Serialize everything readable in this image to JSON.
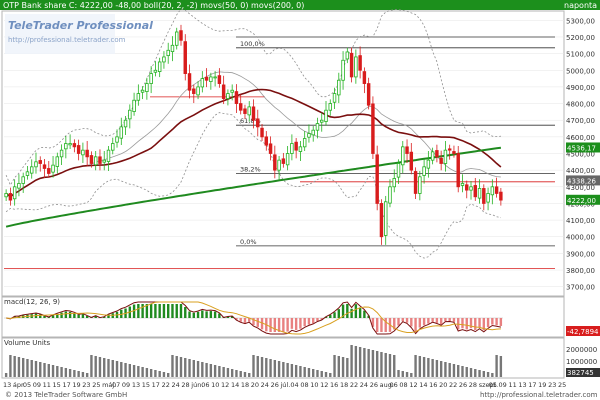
{
  "header": {
    "title": "OTP Bank share  C: 4222,00 -48,00 boll(20, 2, -2) movs(50, 0) movs(200, 0)",
    "right_label": "napontа"
  },
  "watermark": {
    "brand": "TeleTrader Professional",
    "url": "http://professional.teletrader.com"
  },
  "colors": {
    "up": "#22b21f",
    "down": "#d81d1d",
    "ma50": "#7a0f0f",
    "ma200": "#1f8a1f",
    "boll": "#8f8f8f",
    "header_bg": "#1c8f1c",
    "price_tag": "#1c8f1c",
    "sell_tag": "#d81d1d"
  },
  "price_panel": {
    "y_ticks": [
      "5300,00",
      "5200,00",
      "5100,00",
      "5000,00",
      "4900,00",
      "4800,00",
      "4700,00",
      "4600,00",
      "4500,00",
      "4400,00",
      "4300,00",
      "4200,00",
      "4100,00",
      "4000,00",
      "3900,00",
      "3800,00",
      "3700,00"
    ],
    "fib_labels": [
      "100,0%",
      "61,8%",
      "38,2%",
      "0,0%"
    ],
    "fib_levels": [
      5135,
      4670,
      4380,
      3945
    ],
    "price_tags": [
      "4536,17",
      "4222,00",
      "4338,26"
    ],
    "last_price": 4222
  },
  "macd_panel": {
    "title": "macd(12, 26, 9)",
    "value_tag": "-42,7894"
  },
  "volume_panel": {
    "title": "Volume Units",
    "ticks": [
      "2000000",
      "1000000"
    ],
    "value_tag": "382745"
  },
  "x_axis": {
    "labels": [
      "13",
      "ápr.",
      "05",
      "09",
      "11",
      "15",
      "17",
      "19",
      "23",
      "25",
      "máj.",
      "07",
      "09",
      "13",
      "15",
      "17",
      "22",
      "24",
      "28",
      "jún.",
      "06",
      "10",
      "12",
      "14",
      "18",
      "20",
      "24",
      "26",
      "júl.",
      "04",
      "08",
      "10",
      "12",
      "16",
      "18",
      "22",
      "24",
      "26",
      "aug.",
      "06",
      "08",
      "12",
      "14",
      "16",
      "20",
      "22",
      "26",
      "28",
      "szept.",
      "05",
      "09",
      "11",
      "13",
      "17",
      "19",
      "23",
      "25"
    ]
  },
  "footer": {
    "copyright": "© 2013 TeleTrader Software GmbH",
    "url": "http://professional.teletrader.com"
  },
  "chart_data": [
    {
      "type": "candlestick",
      "title": "OTP Bank share",
      "ylim": [
        3650,
        5350
      ],
      "last": 4222,
      "change": -48,
      "closes": [
        4260,
        4220,
        4300,
        4320,
        4360,
        4390,
        4420,
        4450,
        4440,
        4410,
        4380,
        4430,
        4480,
        4520,
        4560,
        4560,
        4540,
        4500,
        4520,
        4480,
        4440,
        4480,
        4440,
        4460,
        4520,
        4560,
        4600,
        4660,
        4700,
        4760,
        4820,
        4860,
        4880,
        4920,
        4980,
        5000,
        5050,
        5080,
        5120,
        5150,
        5230,
        5180,
        4980,
        4880,
        4860,
        4900,
        4950,
        4940,
        4960,
        4960,
        4920,
        4830,
        4860,
        4880,
        4800,
        4760,
        4740,
        4780,
        4700,
        4660,
        4600,
        4550,
        4500,
        4400,
        4460,
        4440,
        4500,
        4560,
        4520,
        4540,
        4590,
        4620,
        4640,
        4680,
        4700,
        4760,
        4800,
        4860,
        4940,
        5060,
        5110,
        4960,
        5080,
        5000,
        4920,
        4790,
        4500,
        4200,
        4000,
        4210,
        4300,
        4350,
        4440,
        4540,
        4500,
        4400,
        4260,
        4360,
        4420,
        4460,
        4510,
        4480,
        4440,
        4520,
        4520,
        4500,
        4300,
        4320,
        4280,
        4300,
        4240,
        4290,
        4200,
        4260,
        4300,
        4260,
        4220
      ]
    },
    {
      "type": "macd",
      "params": [
        12,
        26,
        9
      ],
      "last": -42.7894
    },
    {
      "type": "bar",
      "title": "Volume Units",
      "last": 382745
    }
  ]
}
